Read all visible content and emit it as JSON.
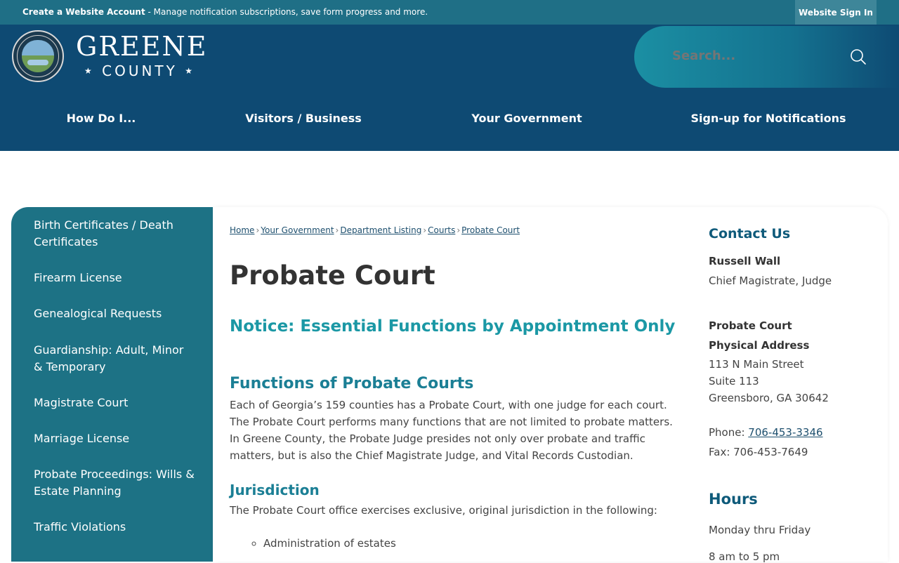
{
  "topbar": {
    "account_link": "Create a Website Account",
    "message": " - Manage notification subscriptions, save form progress and more.",
    "signin_label": "Website Sign In"
  },
  "logo": {
    "seal_text": "GREENE COUNTY",
    "greene": "GREENE",
    "county": "COUNTY"
  },
  "search": {
    "placeholder": "Search..."
  },
  "nav": {
    "items": [
      {
        "label": "How Do I..."
      },
      {
        "label": "Visitors / Business"
      },
      {
        "label": "Your Government"
      },
      {
        "label": "Sign-up for Notifications"
      }
    ]
  },
  "sidebar": {
    "items": [
      {
        "label": "Birth Certificates / Death Certificates"
      },
      {
        "label": "Firearm License"
      },
      {
        "label": "Genealogical Requests"
      },
      {
        "label": "Guardianship: Adult, Minor & Temporary"
      },
      {
        "label": "Magistrate Court"
      },
      {
        "label": "Marriage License"
      },
      {
        "label": "Probate Proceedings: Wills & Estate Planning"
      },
      {
        "label": "Traffic Violations"
      }
    ]
  },
  "breadcrumb": {
    "items": [
      {
        "label": "Home"
      },
      {
        "label": "Your Government"
      },
      {
        "label": "Department Listing"
      },
      {
        "label": "Courts"
      },
      {
        "label": "Probate Court"
      }
    ],
    "separator": "›"
  },
  "main": {
    "title": "Probate Court",
    "notice": "Notice: Essential Functions by Appointment Only",
    "functions_heading": "Functions of Probate Courts",
    "functions_text": "Each of Georgia’s 159 counties has a Probate Court, with one judge for each court. The Probate Court performs many functions that are not limited to probate matters. In Greene County, the Probate Judge presides not only over probate and traffic matters, but is also the Chief Magistrate Judge, and Vital Records Custodian.",
    "jurisdiction_heading": "Jurisdiction",
    "jurisdiction_text": "The Probate Court office exercises exclusive, original jurisdiction in the following:",
    "jurisdiction_items": [
      {
        "label": "Administration of estates"
      }
    ]
  },
  "contact": {
    "heading": "Contact Us",
    "name": "Russell Wall",
    "role": "Chief Magistrate, Judge",
    "office": "Probate Court",
    "address_label": "Physical Address",
    "address_line1": "113 N Main Street",
    "address_line2": "Suite 113",
    "address_line3": "Greensboro, GA 30642",
    "phone_label": "Phone: ",
    "phone": "706-453-3346",
    "fax": "Fax: 706-453-7649",
    "hours_heading": "Hours",
    "hours_days": "Monday thru Friday",
    "hours_time": "8 am to 5 pm"
  }
}
